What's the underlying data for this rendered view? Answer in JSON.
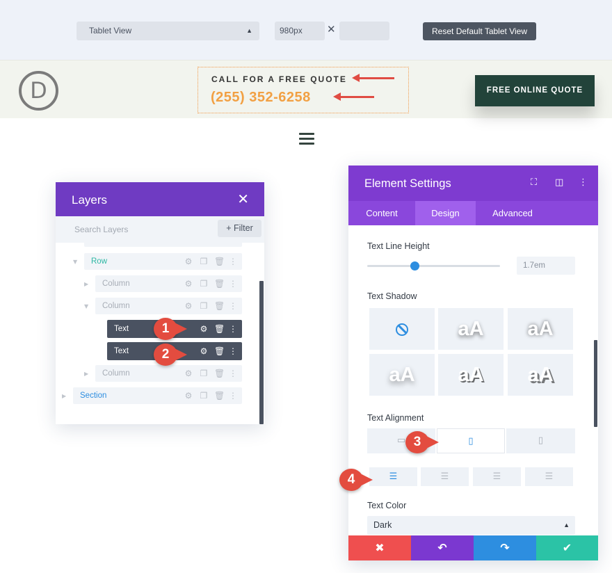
{
  "toolbar": {
    "view_select_value": "Tablet View",
    "width_value": "980px",
    "times_symbol": "✕",
    "reset_label": "Reset Default Tablet View"
  },
  "site": {
    "logo_letter": "D",
    "call_text": "CALL FOR A FREE QUOTE",
    "phone": "(255) 352-6258",
    "cta_label": "FREE ONLINE QUOTE",
    "colors": {
      "header_bg": "#f2f4ee",
      "phone": "#f2a043",
      "cta_bg": "#22433a",
      "arrow": "#e04c43"
    }
  },
  "layers": {
    "title": "Layers",
    "close_symbol": "✕",
    "search_placeholder": "Search Layers",
    "filter_label": "+ Filter",
    "rows": [
      {
        "label": "Row"
      },
      {
        "label": "Column"
      },
      {
        "label": "Column"
      },
      {
        "label": "Text"
      },
      {
        "label": "Text"
      },
      {
        "label": "Column"
      },
      {
        "label": "Section"
      }
    ],
    "colors": {
      "header": "#6f3bc2",
      "selected_row": "#4a5261",
      "row_link": "#2fb8a4",
      "section_link": "#2e8ee0"
    }
  },
  "settings": {
    "title": "Element Settings",
    "tabs": [
      "Content",
      "Design",
      "Advanced"
    ],
    "active_tab": "Design",
    "line_height_label": "Text Line Height",
    "line_height_value": "1.7em",
    "line_height_fraction": 0.35,
    "shadow_label": "Text Shadow",
    "shadow_preview_text": "aA",
    "alignment_label": "Text Alignment",
    "color_label": "Text Color",
    "color_value": "Dark",
    "colors": {
      "header": "#7e3bd0",
      "tabs": "#8a47dc",
      "accent": "#2e8ee0",
      "cancel": "#ef4f4f",
      "undo": "#7b38d0",
      "redo": "#2d8ee0",
      "save": "#2bc3a6"
    }
  },
  "callouts": [
    "1",
    "2",
    "3",
    "4"
  ]
}
